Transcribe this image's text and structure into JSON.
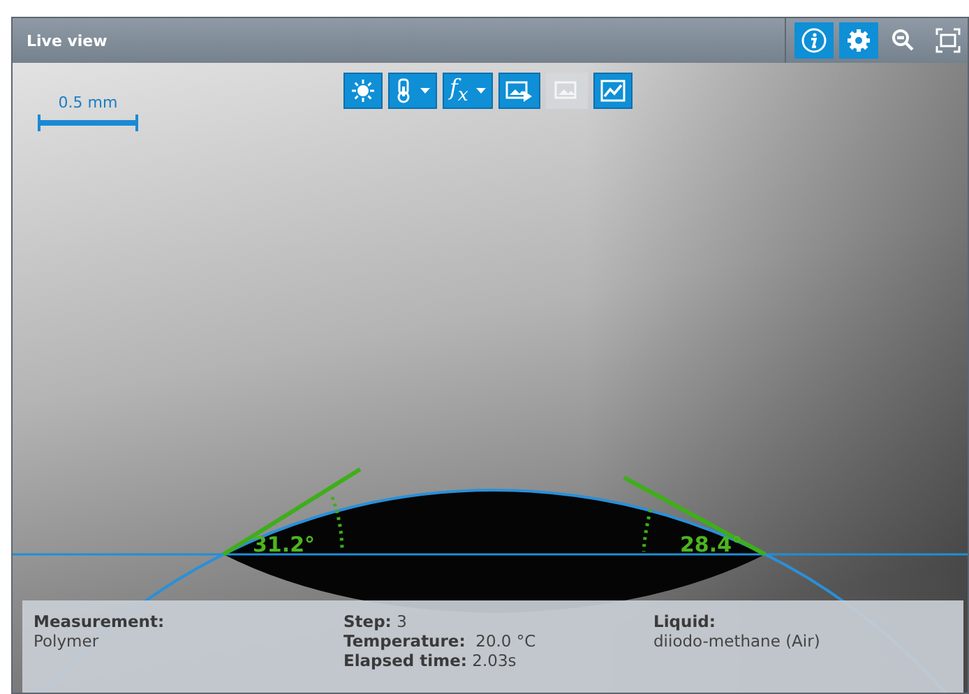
{
  "window": {
    "title": "Live view"
  },
  "title_buttons": [
    {
      "kind": "info",
      "on": true
    },
    {
      "kind": "settings",
      "on": true
    },
    {
      "kind": "zoom",
      "on": false
    },
    {
      "kind": "fullscreen",
      "on": false
    }
  ],
  "toolbar": [
    {
      "kind": "light",
      "dropdown": false,
      "disabled": false
    },
    {
      "kind": "thermometer",
      "dropdown": true,
      "disabled": false
    },
    {
      "kind": "function",
      "label": "f$_{x}$",
      "dropdown": true,
      "disabled": false
    },
    {
      "kind": "image-play",
      "dropdown": false,
      "disabled": false
    },
    {
      "kind": "image",
      "dropdown": false,
      "disabled": true
    },
    {
      "kind": "chart",
      "dropdown": false,
      "disabled": false
    }
  ],
  "scale_bar": {
    "label": "0.5 mm"
  },
  "angles": {
    "left": "31.2°",
    "right": "28.4°"
  },
  "info": [
    {
      "label": "Measurement:",
      "value": "Polymer",
      "kind": "stacked"
    },
    {
      "label": "Step:",
      "value": "3",
      "kind": "inline"
    },
    {
      "label": "Temperature:",
      "value": " 20.0 °C",
      "kind": "inline"
    },
    {
      "label": "Elapsed time:",
      "value": "2.03s",
      "kind": "inline"
    },
    {
      "label": "Liquid:",
      "value": "diiodo-methane (Air)",
      "kind": "stacked"
    }
  ]
}
